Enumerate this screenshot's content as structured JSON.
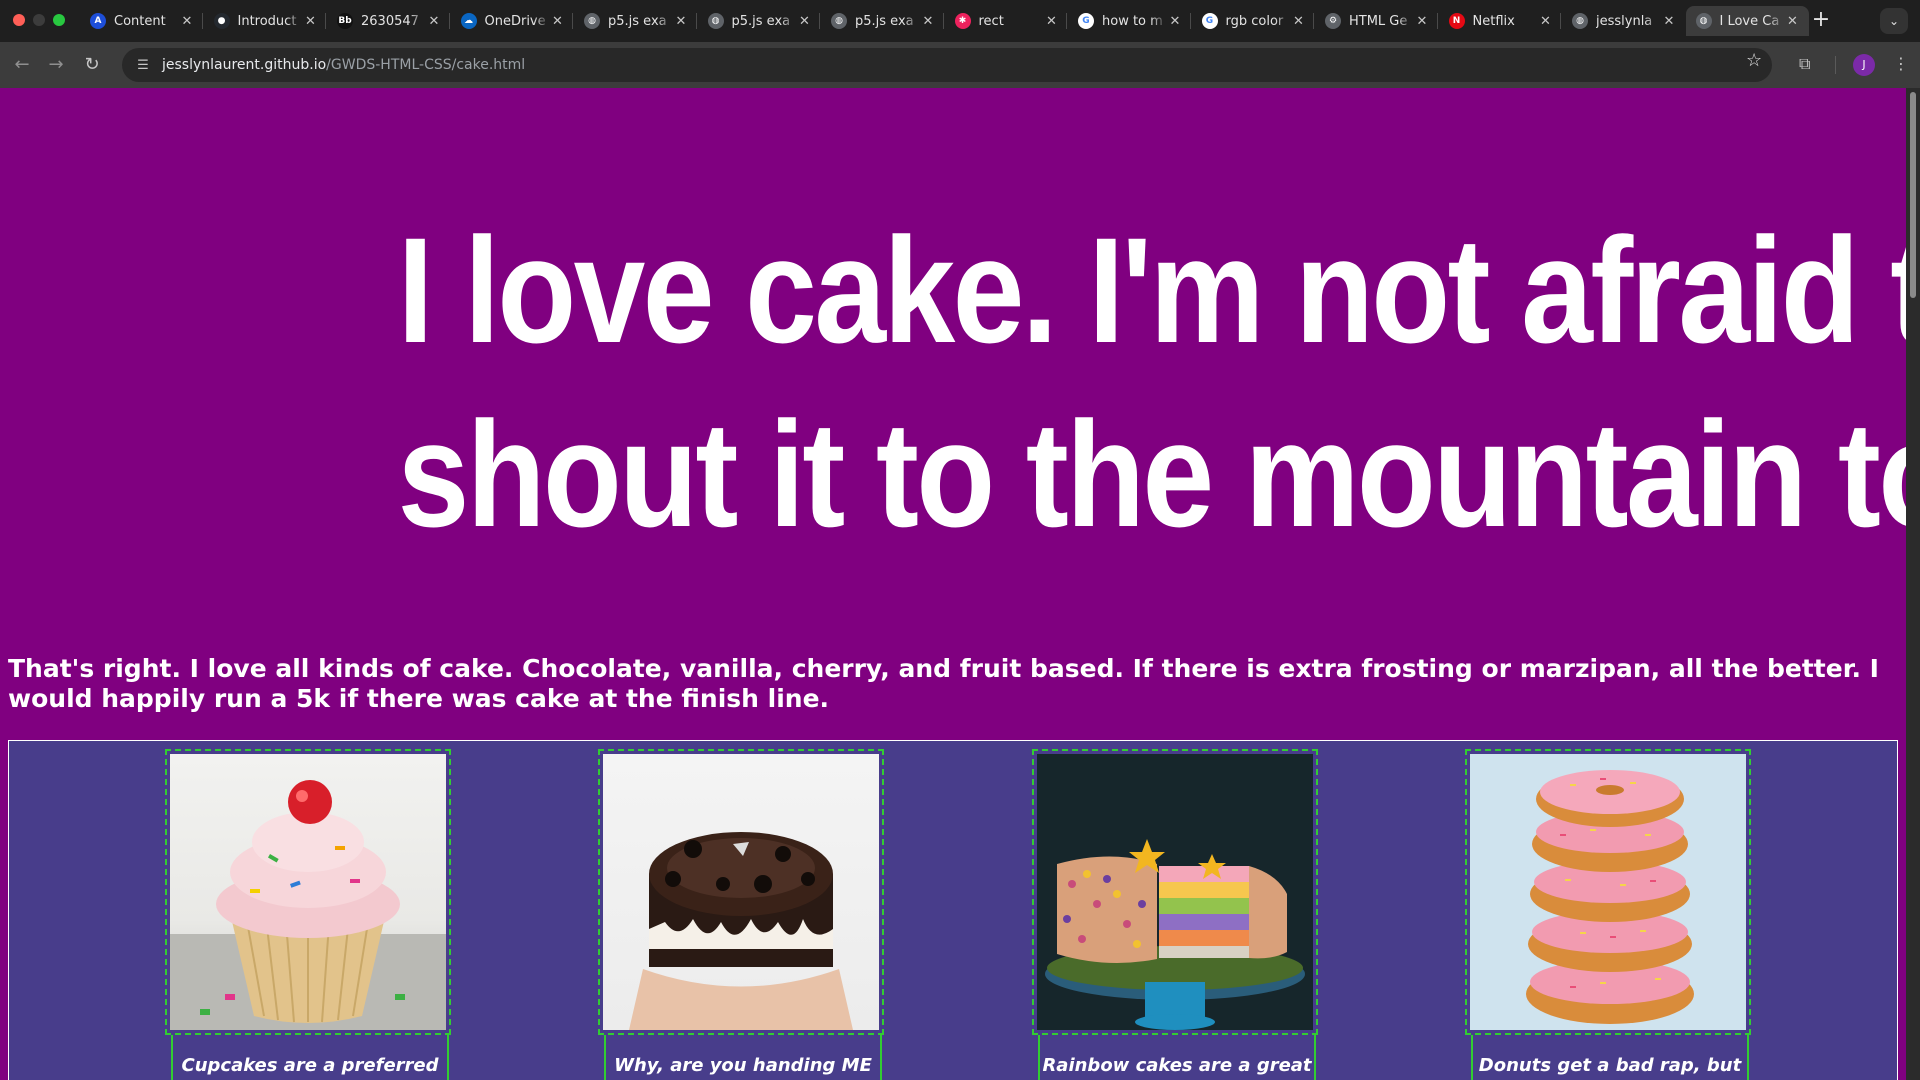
{
  "browser": {
    "tabs": [
      {
        "title": "Content",
        "favicon_color": "#1d4ed8",
        "favicon_text": "A"
      },
      {
        "title": "Introduct",
        "favicon_color": "#24292f",
        "favicon_text": "●"
      },
      {
        "title": "2630547",
        "favicon_color": "#111111",
        "favicon_text": "Bb"
      },
      {
        "title": "OneDrive",
        "favicon_color": "#0a66c2",
        "favicon_text": "☁"
      },
      {
        "title": "p5.js exa",
        "favicon_color": "#5f6368",
        "favicon_text": "◍"
      },
      {
        "title": "p5.js exa",
        "favicon_color": "#5f6368",
        "favicon_text": "◍"
      },
      {
        "title": "p5.js exa",
        "favicon_color": "#5f6368",
        "favicon_text": "◍"
      },
      {
        "title": "rect",
        "favicon_color": "#ed225d",
        "favicon_text": "✱"
      },
      {
        "title": "how to m",
        "favicon_color": "#ffffff",
        "favicon_text": "G"
      },
      {
        "title": "rgb color",
        "favicon_color": "#ffffff",
        "favicon_text": "G"
      },
      {
        "title": "HTML Ge",
        "favicon_color": "#5f6368",
        "favicon_text": "⚙"
      },
      {
        "title": "Netflix",
        "favicon_color": "#e50914",
        "favicon_text": "N"
      },
      {
        "title": "jesslynla",
        "favicon_color": "#5f6368",
        "favicon_text": "◍"
      },
      {
        "title": "I Love Ca",
        "favicon_color": "#5f6368",
        "favicon_text": "◍"
      }
    ],
    "close_glyph": "✕",
    "new_tab_glyph": "+",
    "url_host": "jesslynlaurent.github.io",
    "url_path": "/GWDS-HTML-CSS/cake.html",
    "avatar_initial": "J"
  },
  "page": {
    "headline_line1": "I love cake. I'm not afraid to",
    "headline_line2": "shout it to the mountain top.",
    "intro": "That's right. I love all kinds of cake. Chocolate, vanilla, cherry, and fruit based. If there is extra frosting or marzipan, all the better. I would happily run a 5k if there was cake at the finish line.",
    "cards": [
      {
        "caption": "Cupcakes are a preferred way to"
      },
      {
        "caption": "Why, are you handing ME an"
      },
      {
        "caption": "Rainbow cakes are a great way"
      },
      {
        "caption": "Donuts get a bad rap, but I"
      }
    ]
  },
  "colors": {
    "page_background": "#800080",
    "gallery_background": "#483d8b",
    "frame_border": "#32cd32"
  }
}
